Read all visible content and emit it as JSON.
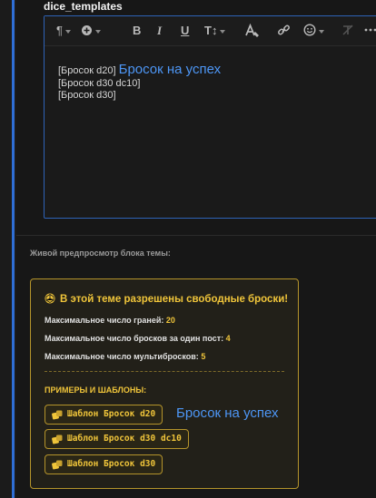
{
  "field": {
    "title": "dice_templates"
  },
  "toolbar": {
    "icons": [
      "paragraph-icon",
      "plus-circle-icon",
      "bold-icon",
      "italic-icon",
      "underline-icon",
      "text-size-icon",
      "text-color-icon",
      "link-icon",
      "emoji-icon",
      "clear-format-icon",
      "more-icon"
    ],
    "labels": {
      "bold": "B",
      "italic": "I",
      "underline": "U",
      "textsize": "T↕"
    }
  },
  "editor": {
    "lines": [
      {
        "tag": "[Бросок d20]",
        "extra": "Бросок на успех"
      },
      {
        "tag": "[Бросок d30 dc10]"
      },
      {
        "tag": "[Бросок d30]"
      }
    ]
  },
  "preview": {
    "label": "Живой предпросмотр блока темы:",
    "title": "В этой теме разрешены свободные броски!",
    "rows": [
      {
        "label": "Максимальное число граней:",
        "value": "20"
      },
      {
        "label": "Максимальное число бросков за один пост:",
        "value": "4"
      },
      {
        "label": "Максимальное число мультибросков:",
        "value": "5"
      }
    ],
    "examples_heading": "ПРИМЕРЫ И ШАБЛОНЫ:",
    "chips": [
      {
        "label": "Шаблон Бросок d20"
      },
      {
        "label": "Шаблон Бросок d30 dc10"
      },
      {
        "label": "Шаблон Бросок d30"
      }
    ],
    "chip_extra": "Бросок на успех"
  },
  "colors": {
    "accent_blue": "#2f6fd6",
    "gold": "#f0c53a",
    "link_blue": "#4d96f5"
  }
}
